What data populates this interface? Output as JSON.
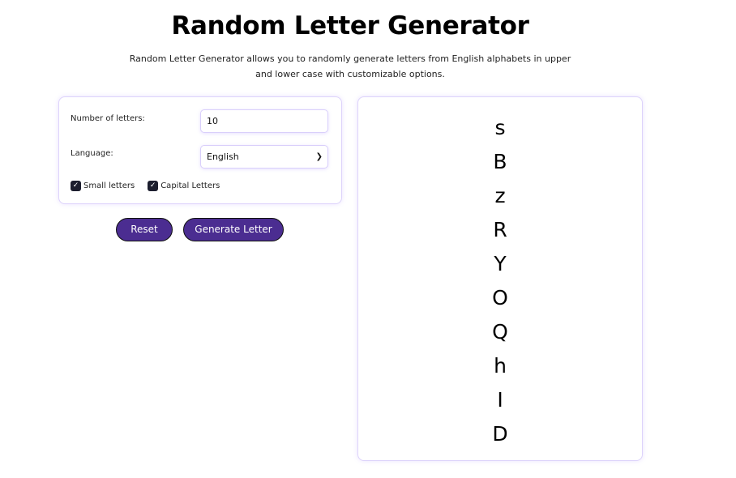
{
  "header": {
    "title": "Random Letter Generator",
    "description": "Random Letter Generator allows you to randomly generate letters from English alphabets in upper and lower case with customizable options."
  },
  "options": {
    "count_label": "Number of letters:",
    "count_value": "10",
    "language_label": "Language:",
    "language_value": "English",
    "small_letters_label": "Small letters",
    "small_letters_checked": true,
    "capital_letters_label": "Capital Letters",
    "capital_letters_checked": true
  },
  "buttons": {
    "reset_label": "Reset",
    "generate_label": "Generate Letter"
  },
  "results": {
    "letters": [
      "s",
      "B",
      "z",
      "R",
      "Y",
      "O",
      "Q",
      "h",
      "I",
      "D"
    ]
  },
  "colors": {
    "button_bg": "#4b2d91",
    "card_border": "#ddd3fb"
  }
}
